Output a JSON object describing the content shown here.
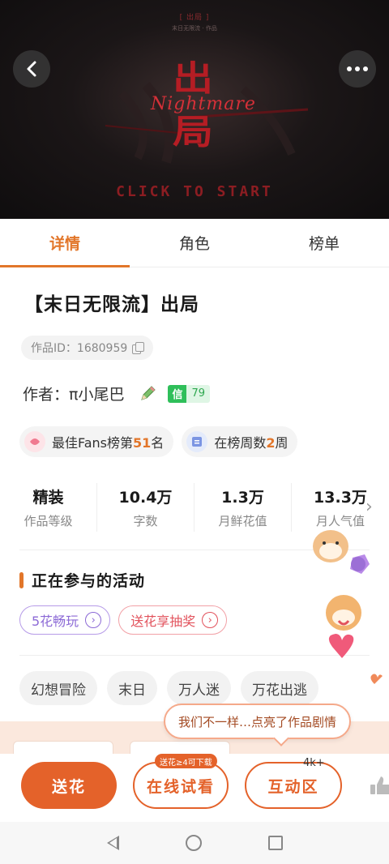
{
  "banner": {
    "mini_title": "[ 出局 ]",
    "mini_sub": "末日无限流 · 作品",
    "logo_cn_top": "出",
    "logo_cn_bottom": "局",
    "logo_en": "Nightmare",
    "click_to_start": "CLICK TO START",
    "logo_color": "#b51d24"
  },
  "tabs": [
    {
      "label": "详情",
      "active": true
    },
    {
      "label": "角色",
      "active": false
    },
    {
      "label": "榜单",
      "active": false
    }
  ],
  "work": {
    "title": "【末日无限流】出局",
    "id_label": "作品ID：1680959",
    "author_label": "作者：",
    "author_name": "π小尾巴",
    "trust_key": "信",
    "trust_value": "79"
  },
  "rank_pills": {
    "fans_prefix": "最佳Fans榜第",
    "fans_rank": "51",
    "fans_suffix": "名",
    "weeks_prefix": "在榜周数",
    "weeks_value": "2",
    "weeks_suffix": "周"
  },
  "stats": [
    {
      "value": "精装",
      "label": "作品等级"
    },
    {
      "value": "10.4万",
      "label": "字数"
    },
    {
      "value": "1.3万",
      "label": "月鲜花值"
    },
    {
      "value": "13.3万",
      "label": "月人气值"
    }
  ],
  "activities": {
    "title": "正在参与的活动",
    "items": [
      {
        "label": "5花畅玩",
        "color": "#8c6ad6"
      },
      {
        "label": "送花享抽奖",
        "color": "#e2525c"
      }
    ]
  },
  "tags": [
    "幻想冒险",
    "末日",
    "万人迷",
    "万花出逃"
  ],
  "bubble_text": "我们不一样…点亮了作品剧情",
  "bottom": {
    "gift_label": "送花",
    "trial_label": "在线试看",
    "trial_note": "送花≥4可下载",
    "interact_label": "互动区",
    "interact_count": "4k+",
    "accent": "#e4622a"
  }
}
